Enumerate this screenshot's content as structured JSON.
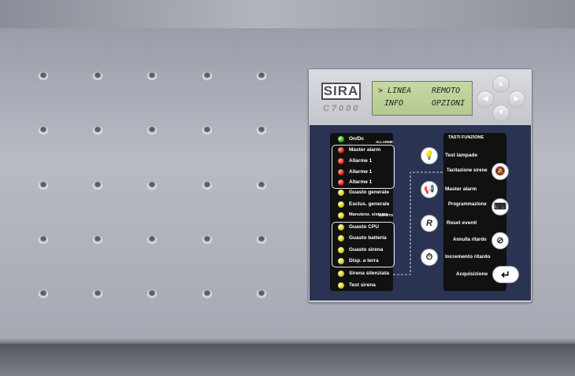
{
  "device": {
    "brand": "SIRA",
    "model": "C7000",
    "display": {
      "line1_left": "> LINEA",
      "line1_right": "REMOTO",
      "line2_left": "INFO",
      "line2_right": "OPZIONI"
    },
    "nav": {
      "up": "▲",
      "down": "▼",
      "left": "◀",
      "right": "▶"
    }
  },
  "status_panel": {
    "section_alarms": "ALLARME",
    "section_faults": "GUASTO",
    "leds": [
      {
        "label": "On/Dc",
        "color": "green"
      },
      {
        "label": "Master alarm",
        "color": "red"
      },
      {
        "label": "Allarme 1",
        "color": "red"
      },
      {
        "label": "Allarme 1",
        "color": "red"
      },
      {
        "label": "Allarme 1",
        "color": "red"
      },
      {
        "label": "Guasto generale",
        "color": "yellow"
      },
      {
        "label": "Esclus. generale",
        "color": "yellow"
      },
      {
        "label": "Manutenz. sistema",
        "color": "yellow"
      },
      {
        "label": "Guasto CPU",
        "color": "yellow"
      },
      {
        "label": "Guasto batteria",
        "color": "yellow"
      },
      {
        "label": "Guasto sirena",
        "color": "yellow"
      },
      {
        "label": "Disp.  a  terra",
        "color": "yellow"
      },
      {
        "label": "Sirena silenziata",
        "color": "yellow"
      },
      {
        "label": "Test sirena",
        "color": "yellow"
      }
    ]
  },
  "function_panel": {
    "title": "TASTI FUNZIONE",
    "buttons": [
      {
        "label": "Test lampade",
        "icon": "lamp-icon",
        "glyph": "💡"
      },
      {
        "label": "Tacitazione sirene",
        "icon": "siren-mute-icon",
        "glyph": "🔕"
      },
      {
        "label": "Master alarm",
        "icon": "megaphone-icon",
        "glyph": "📢"
      },
      {
        "label": "Programmazione",
        "icon": "keyboard-icon",
        "glyph": "⌨"
      },
      {
        "label": "Reset eventi",
        "icon": "reset-icon",
        "glyph": "R"
      },
      {
        "label": "Annulla ritardo",
        "icon": "cancel-delay-icon",
        "glyph": "⊘"
      },
      {
        "label": "Incremento ritardo",
        "icon": "increase-delay-icon",
        "glyph": "⏱"
      },
      {
        "label": "Acquisizione",
        "icon": "enter-icon",
        "glyph": "↵"
      }
    ]
  }
}
